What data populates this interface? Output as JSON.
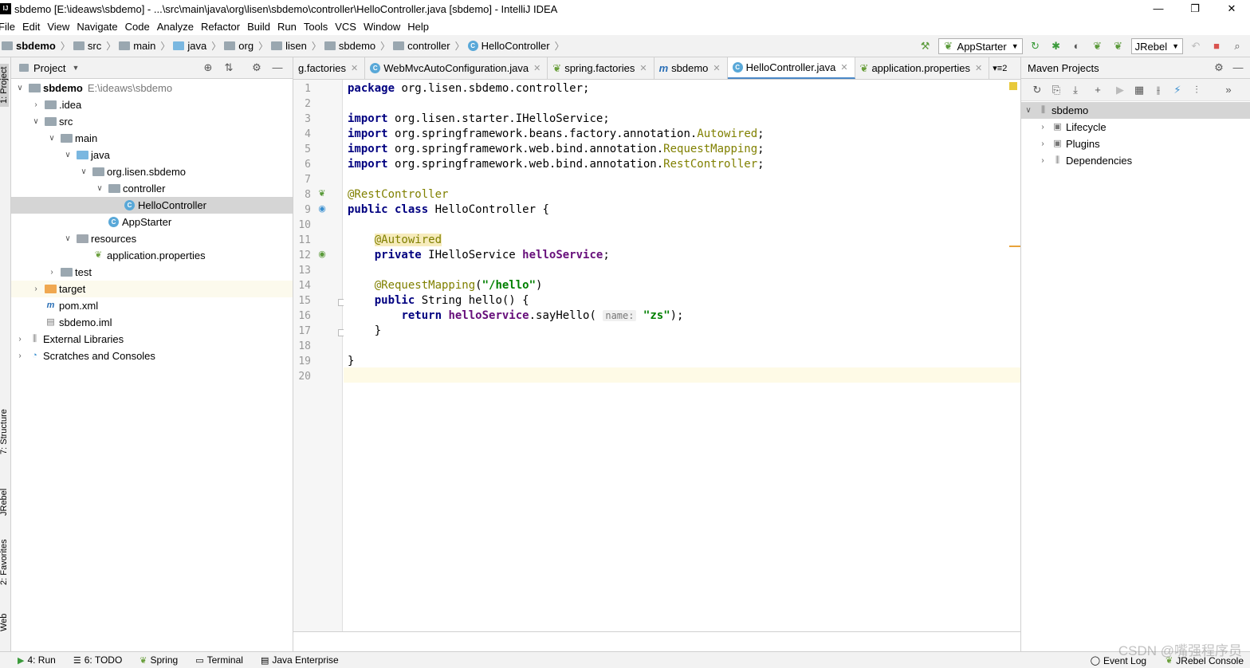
{
  "window": {
    "title": "sbdemo [E:\\ideaws\\sbdemo] - ...\\src\\main\\java\\org\\lisen\\sbdemo\\controller\\HelloController.java [sbdemo] - IntelliJ IDEA",
    "minimize": "—",
    "restore": "❐",
    "close": "✕"
  },
  "menu": [
    "File",
    "Edit",
    "View",
    "Navigate",
    "Code",
    "Analyze",
    "Refactor",
    "Build",
    "Run",
    "Tools",
    "VCS",
    "Window",
    "Help"
  ],
  "breadcrumb": [
    "sbdemo",
    "src",
    "main",
    "java",
    "org",
    "lisen",
    "sbdemo",
    "controller",
    "HelloController"
  ],
  "toolbar": {
    "run_config": "AppStarter",
    "jrebel_config": "JRebel"
  },
  "left_strip": {
    "project": "1: Project",
    "structure": "7: Structure",
    "jrebel": "JRebel",
    "favorites": "2: Favorites",
    "web": "Web"
  },
  "project_panel": {
    "title": "Project",
    "tree": [
      {
        "label": "sbdemo",
        "sub": "E:\\ideaws\\sbdemo"
      },
      {
        "label": ".idea"
      },
      {
        "label": "src"
      },
      {
        "label": "main"
      },
      {
        "label": "java"
      },
      {
        "label": "org.lisen.sbdemo"
      },
      {
        "label": "controller"
      },
      {
        "label": "HelloController"
      },
      {
        "label": "AppStarter"
      },
      {
        "label": "resources"
      },
      {
        "label": "application.properties"
      },
      {
        "label": "test"
      },
      {
        "label": "target"
      },
      {
        "label": "pom.xml"
      },
      {
        "label": "sbdemo.iml"
      },
      {
        "label": "External Libraries"
      },
      {
        "label": "Scratches and Consoles"
      }
    ]
  },
  "tabs": [
    {
      "label": "g.factories"
    },
    {
      "label": "WebMvcAutoConfiguration.java"
    },
    {
      "label": "spring.factories"
    },
    {
      "label": "sbdemo"
    },
    {
      "label": "HelloController.java",
      "active": true
    },
    {
      "label": "application.properties"
    }
  ],
  "tab_overflow": "▾≡2",
  "editor": {
    "line_numbers": [
      "1",
      "2",
      "3",
      "4",
      "5",
      "6",
      "7",
      "8",
      "9",
      "10",
      "11",
      "12",
      "13",
      "14",
      "15",
      "16",
      "17",
      "18",
      "19",
      "20"
    ],
    "l1": {
      "kw": "package",
      "rest": " org.lisen.sbdemo.controller;"
    },
    "l3": {
      "kw": "import",
      "rest": " org.lisen.starter.IHelloService;"
    },
    "l4": {
      "kw": "import",
      "rest": " org.springframework.beans.factory.annotation.",
      "ann": "Autowired",
      "end": ";"
    },
    "l5": {
      "kw": "import",
      "rest": " org.springframework.web.bind.annotation.",
      "ann": "RequestMapping",
      "end": ";"
    },
    "l6": {
      "kw": "import",
      "rest": " org.springframework.web.bind.annotation.",
      "ann": "RestController",
      "end": ";"
    },
    "l8": {
      "ann": "@RestController"
    },
    "l9": {
      "kw": "public class",
      "rest": " HelloController {"
    },
    "l11": {
      "ann": "@Autowired"
    },
    "l12": {
      "kw": "private",
      "rest": " IHelloService ",
      "fld": "helloService",
      "end": ";"
    },
    "l14": {
      "ann": "@RequestMapping",
      "open": "(",
      "str": "\"/hello\"",
      "close": ")"
    },
    "l15": {
      "kw": "public",
      "rest": " String hello() {"
    },
    "l16": {
      "kw": "return",
      "fld": "helloService",
      "call": ".sayHello(",
      "hint": "name:",
      "str": "\"zs\"",
      "end": ");"
    },
    "l17": {
      "text": "}"
    },
    "l19": {
      "text": "}"
    }
  },
  "maven": {
    "title": "Maven Projects",
    "tree": [
      {
        "label": "sbdemo"
      },
      {
        "label": "Lifecycle"
      },
      {
        "label": "Plugins"
      },
      {
        "label": "Dependencies"
      }
    ]
  },
  "statusbar": {
    "run": "4: Run",
    "todo": "6: TODO",
    "spring": "Spring",
    "terminal": "Terminal",
    "java_enterprise": "Java Enterprise",
    "event_log": "Event Log",
    "jrebel_console": "JRebel Console"
  },
  "watermark": "CSDN @嘴强程序员"
}
